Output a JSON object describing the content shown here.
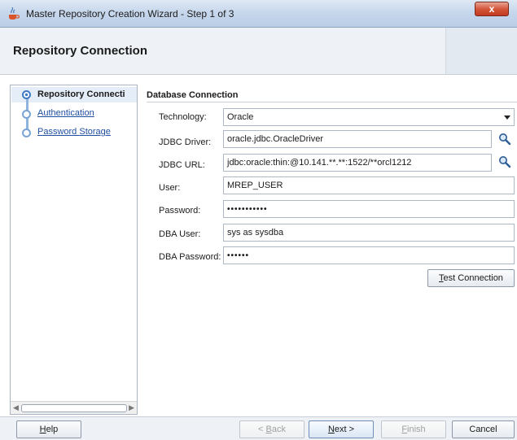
{
  "window": {
    "title": "Master Repository Creation Wizard - Step 1 of 3",
    "close_glyph": "x"
  },
  "header": {
    "page_title": "Repository Connection"
  },
  "nav": {
    "items": [
      {
        "label": "Repository Connecti",
        "state": "active"
      },
      {
        "label": "Authentication",
        "state": "link"
      },
      {
        "label": "Password Storage",
        "state": "link"
      }
    ]
  },
  "section": {
    "title": "Database Connection"
  },
  "form": {
    "technology": {
      "label": "Technology:",
      "value": "Oracle"
    },
    "jdbc_driver": {
      "label": "JDBC Driver:",
      "value": "oracle.jdbc.OracleDriver"
    },
    "jdbc_url": {
      "label": "JDBC URL:",
      "value": "jdbc:oracle:thin:@10.141.**.**:1522/**orcl1212"
    },
    "user": {
      "label": "User:",
      "value": "MREP_USER"
    },
    "password": {
      "label": "Password:",
      "value": "•••••••••••"
    },
    "dba_user": {
      "label": "DBA User:",
      "value": "sys as sysdba"
    },
    "dba_password": {
      "label": "DBA Password:",
      "value": "••••••"
    }
  },
  "buttons": {
    "test_connection": {
      "mnemonic": "T",
      "rest": "est Connection"
    },
    "help": {
      "mnemonic": "H",
      "rest": "elp"
    },
    "back": {
      "prefix": "< ",
      "mnemonic": "B",
      "rest": "ack"
    },
    "next": {
      "mnemonic": "N",
      "rest": "ext >"
    },
    "finish": {
      "mnemonic": "F",
      "rest": "inish"
    },
    "cancel": {
      "label": "Cancel"
    }
  },
  "colors": {
    "accent": "#3f79c4",
    "link": "#1f4fa0",
    "close_button": "#c23b21"
  },
  "icons": {
    "app": "java-cup-icon",
    "browse": "magnifier-icon",
    "dropdown": "chevron-down-icon"
  }
}
